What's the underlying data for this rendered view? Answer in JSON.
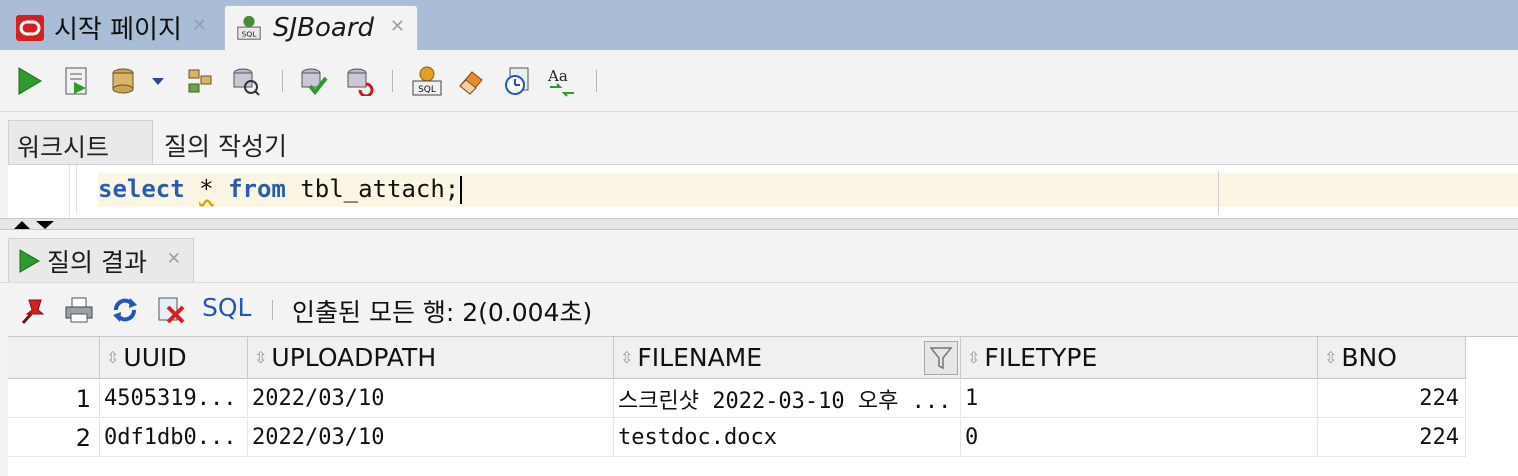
{
  "tabs": [
    {
      "label": "시작 페이지",
      "icon": "oracle-icon",
      "active": false
    },
    {
      "label": "SJBoard",
      "icon": "sql-worksheet-icon",
      "active": true
    }
  ],
  "toolbar": {
    "buttons": [
      "run-statement-icon",
      "run-script-icon",
      "commit-icon",
      "explain-plan-icon",
      "autotrace-icon",
      "commit-check-icon",
      "rollback-icon",
      "sql-tuning-icon",
      "clear-eraser-icon",
      "history-icon",
      "text-case-icon"
    ]
  },
  "worksheet": {
    "subtabs": [
      "워크시트",
      "질의 작성기"
    ],
    "code": {
      "kw1": "select",
      "star": "*",
      "kw2": "from",
      "rest": " tbl_attach;"
    }
  },
  "results": {
    "tab_label": "질의 결과",
    "sql_label": "SQL",
    "status": "인출된 모든 행: 2(0.004초)",
    "columns": [
      "UUID",
      "UPLOADPATH",
      "FILENAME",
      "FILETYPE",
      "BNO"
    ],
    "rows": [
      {
        "num": "1",
        "uuid": "4505319...",
        "uploadpath": "2022/03/10",
        "filename": "스크린샷 2022-03-10 오후 ...",
        "filetype": "1",
        "bno": "224"
      },
      {
        "num": "2",
        "uuid": "0df1db0...",
        "uploadpath": "2022/03/10",
        "filename": "testdoc.docx",
        "filetype": "0",
        "bno": "224"
      }
    ]
  }
}
